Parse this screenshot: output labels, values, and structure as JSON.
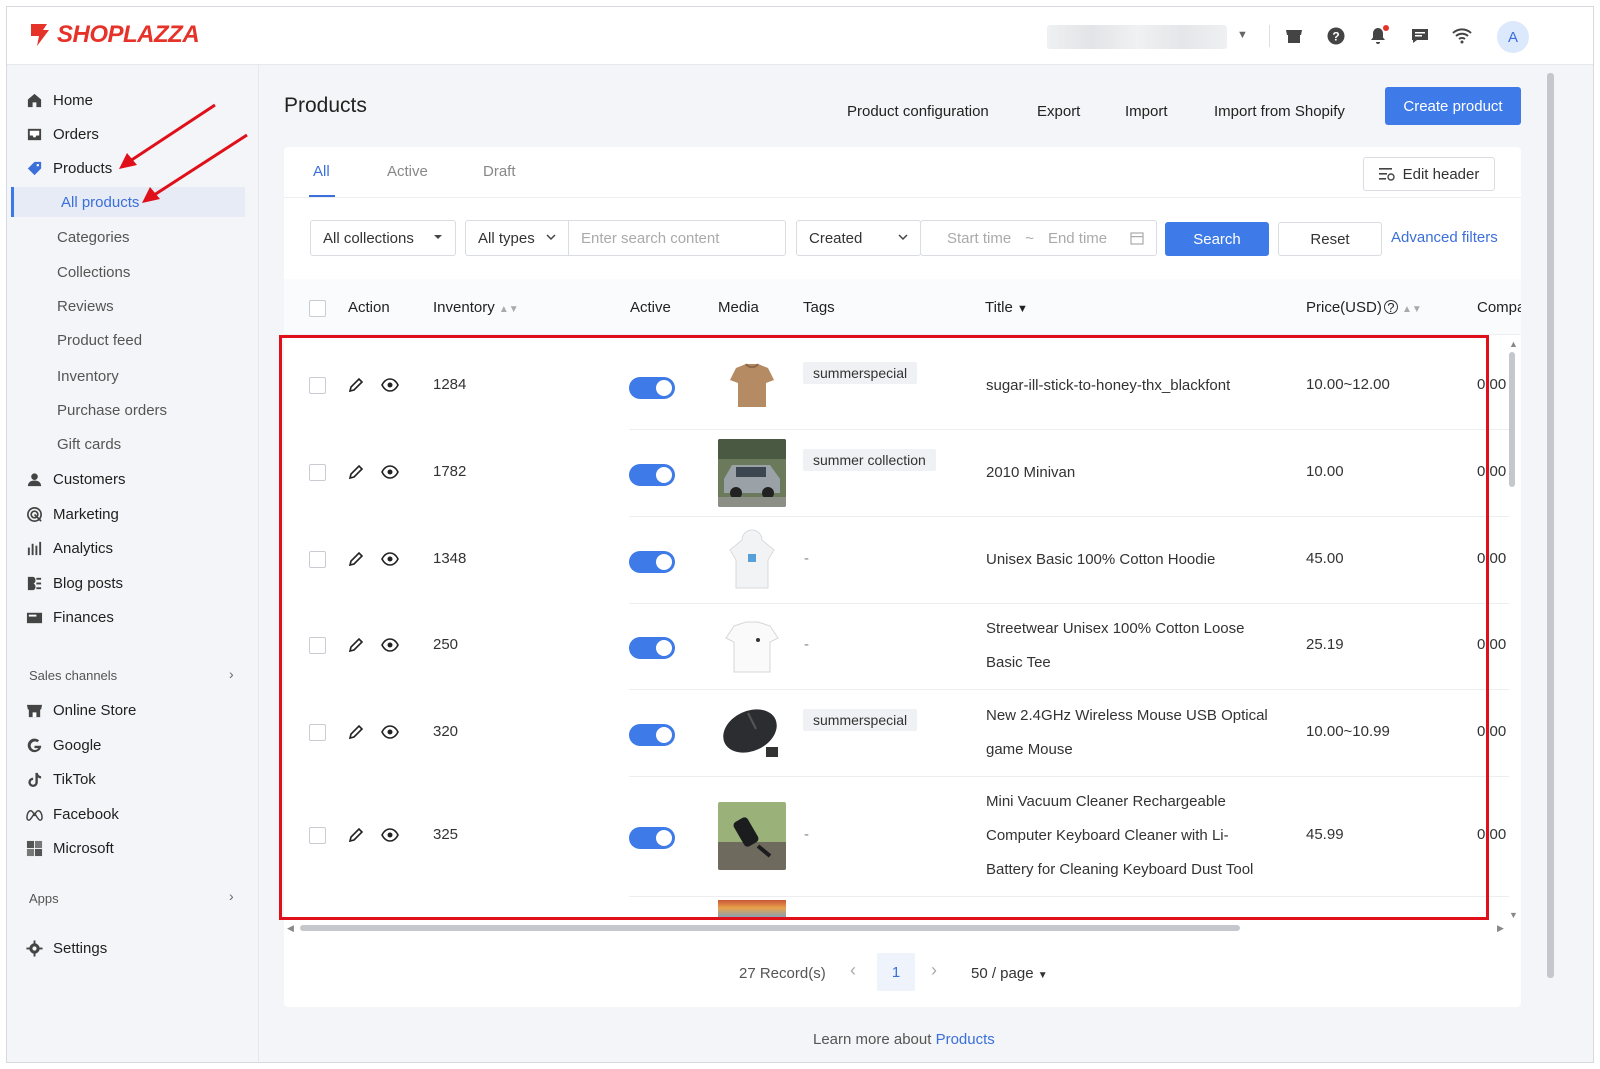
{
  "brand": {
    "name": "SHOPLAZZA",
    "color": "#e6332a"
  },
  "accent": "#3e7ae8",
  "topbar": {
    "icons": [
      "store-icon",
      "help-icon",
      "bell-icon",
      "chat-icon",
      "wifi-icon"
    ],
    "avatar_letter": "A"
  },
  "sidebar": {
    "home": "Home",
    "orders": "Orders",
    "products": "Products",
    "all_products": "All products",
    "categories": "Categories",
    "collections": "Collections",
    "reviews": "Reviews",
    "product_feed": "Product feed",
    "inventory": "Inventory",
    "purchase_orders": "Purchase orders",
    "gift_cards": "Gift cards",
    "customers": "Customers",
    "marketing": "Marketing",
    "analytics": "Analytics",
    "blog_posts": "Blog posts",
    "finances": "Finances",
    "sales_channels": "Sales channels",
    "online_store": "Online Store",
    "google": "Google",
    "tiktok": "TikTok",
    "facebook": "Facebook",
    "microsoft": "Microsoft",
    "apps": "Apps",
    "settings": "Settings"
  },
  "header": {
    "title": "Products",
    "product_configuration": "Product configuration",
    "export": "Export",
    "import": "Import",
    "import_shopify": "Import from Shopify",
    "create_product": "Create product"
  },
  "tabs": {
    "all": "All",
    "active": "Active",
    "draft": "Draft",
    "edit_header": "Edit header"
  },
  "filters": {
    "collections": "All collections",
    "types": "All types",
    "search_placeholder": "Enter search content",
    "date_field": "Created",
    "start_time": "Start time",
    "tilde": "~",
    "end_time": "End time",
    "search": "Search",
    "reset": "Reset",
    "advanced": "Advanced filters"
  },
  "columns": {
    "action": "Action",
    "inventory": "Inventory",
    "active": "Active",
    "media": "Media",
    "tags": "Tags",
    "title": "Title",
    "price": "Price(USD)",
    "compare": "Compa"
  },
  "rows": [
    {
      "inventory": "1284",
      "tag": "summerspecial",
      "title": "sugar-ill-stick-to-honey-thx_blackfont",
      "price": "10.00~12.00",
      "compare": "0.00"
    },
    {
      "inventory": "1782",
      "tag": "summer collection",
      "title": "2010 Minivan",
      "price": "10.00",
      "compare": "0.00"
    },
    {
      "inventory": "1348",
      "tag": "-",
      "title": "Unisex Basic 100% Cotton Hoodie",
      "price": "45.00",
      "compare": "0.00"
    },
    {
      "inventory": "250",
      "tag": "-",
      "title": "Streetwear Unisex 100% Cotton Loose Basic Tee",
      "price": "25.19",
      "compare": "0.00"
    },
    {
      "inventory": "320",
      "tag": "summerspecial",
      "title": "New 2.4GHz Wireless Mouse USB Optical game Mouse",
      "price": "10.00~10.99",
      "compare": "0.00"
    },
    {
      "inventory": "325",
      "tag": "-",
      "title": "Mini Vacuum Cleaner Rechargeable Computer Keyboard Cleaner with Li-Battery for Cleaning Keyboard Dust Tool",
      "price": "45.99",
      "compare": "0.00"
    }
  ],
  "pagination": {
    "records": "27 Record(s)",
    "page": "1",
    "per_page": "50 / page"
  },
  "footer": {
    "learn_prefix": "Learn more about",
    "learn_link": "Products"
  }
}
